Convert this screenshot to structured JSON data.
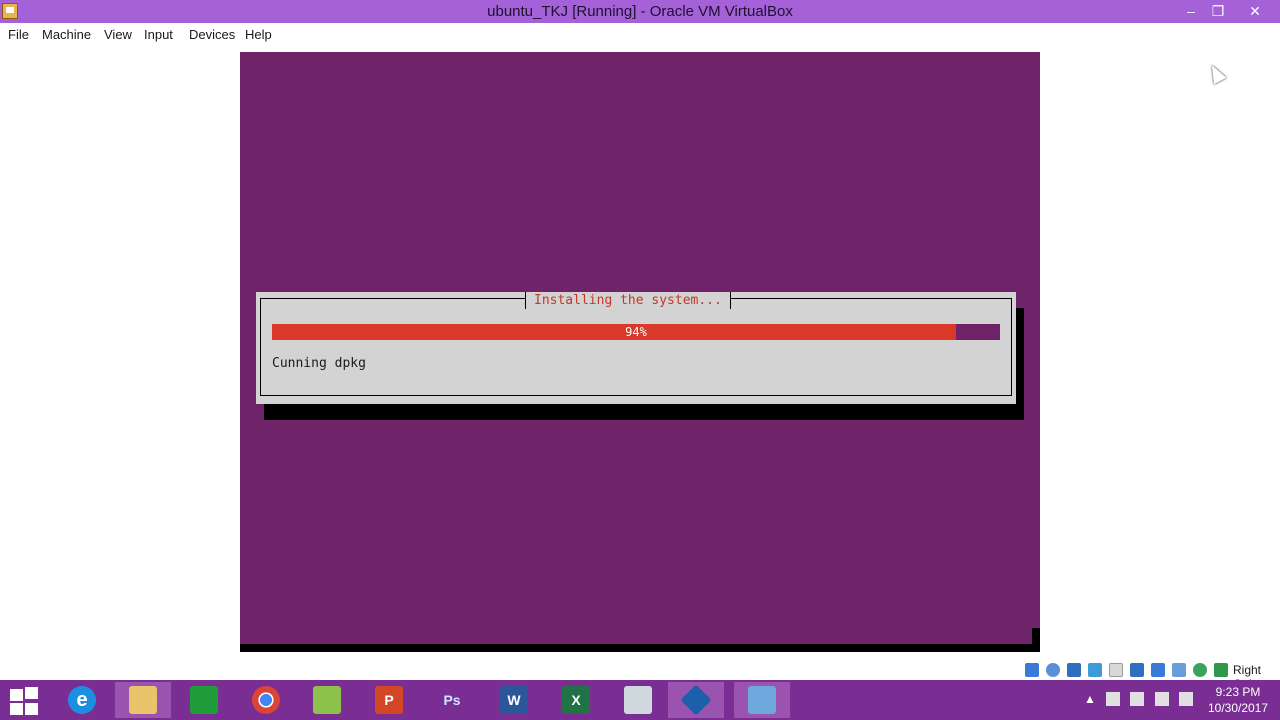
{
  "window": {
    "title": "ubuntu_TKJ [Running] - Oracle VM VirtualBox",
    "minimize_glyph": "–",
    "restore_glyph": "❐",
    "close_glyph": "✕"
  },
  "menubar": {
    "items": [
      "File",
      "Machine",
      "View",
      "Input",
      "Devices",
      "Help"
    ]
  },
  "installer": {
    "dialog_title": "Installing the system...",
    "progress_percent": 94,
    "progress_label": "94%",
    "status_text": "Cunning dpkg",
    "colors": {
      "background": "#6f2369",
      "dialog": "#d3d3d3",
      "progress_fill": "#d9392b",
      "title_text": "#c0392b"
    }
  },
  "statusbar": {
    "icons": [
      "hard-disk-icon",
      "optical-drive-icon",
      "network-icon",
      "usb-icon",
      "shared-folders-icon",
      "display-icon",
      "video-capture-icon",
      "cpu-icon",
      "mouse-integration-icon",
      "keyboard-icon"
    ],
    "host_key": "Right Ctrl"
  },
  "taskbar": {
    "apps": [
      "internet-explorer-icon",
      "file-explorer-icon",
      "store-icon",
      "chrome-icon",
      "green-app-icon",
      "powerpoint-icon",
      "photoshop-icon",
      "word-icon",
      "excel-icon",
      "calculator-icon",
      "virtualbox-icon",
      "video-app-icon"
    ],
    "app_glyphs": [
      "e",
      "",
      "",
      "",
      "",
      "P",
      "Ps",
      "W",
      "X",
      "",
      "",
      ""
    ],
    "clock_time": "9:23 PM",
    "clock_date": "10/30/2017",
    "tray_chevron": "▲"
  }
}
